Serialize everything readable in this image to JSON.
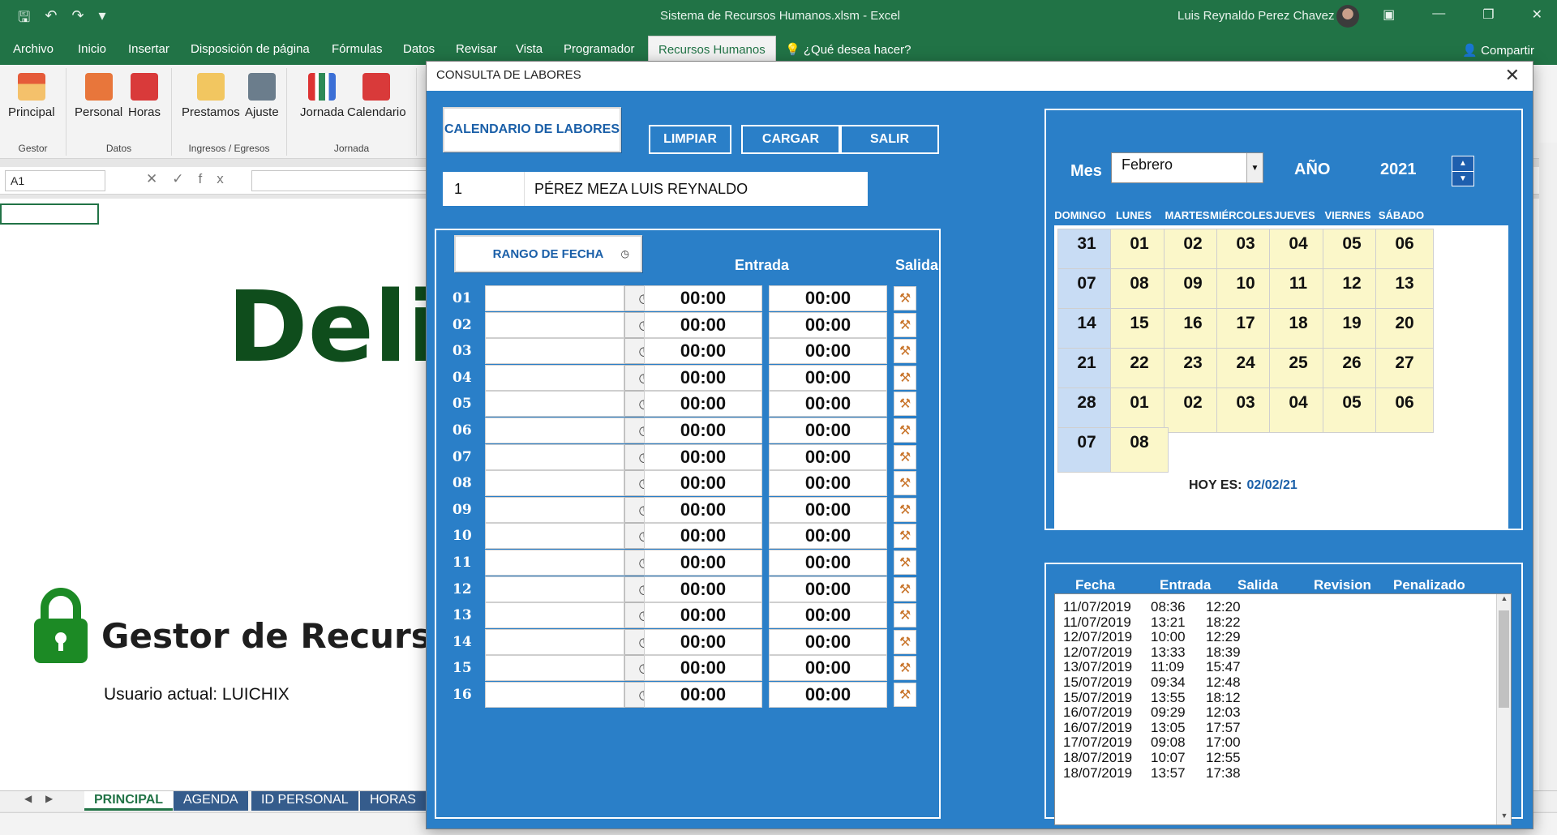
{
  "window": {
    "title": "Sistema de Recursos Humanos.xlsm  -  Excel",
    "user": "Luis Reynaldo Perez Chavez"
  },
  "ribbon_tabs": [
    "Archivo",
    "Inicio",
    "Insertar",
    "Disposición de página",
    "Fórmulas",
    "Datos",
    "Revisar",
    "Vista",
    "Programador",
    "Recursos Humanos"
  ],
  "tell_me": "¿Qué desea hacer?",
  "share": "Compartir",
  "ribbon_groups": [
    {
      "label": "Gestor",
      "buttons": [
        "Principal"
      ]
    },
    {
      "label": "Datos",
      "buttons": [
        "Personal",
        "Horas"
      ]
    },
    {
      "label": "Ingresos / Egresos",
      "buttons": [
        "Prestamos",
        "Ajuste"
      ]
    },
    {
      "label": "Jornada",
      "buttons": [
        "Jornada",
        "Calendario"
      ]
    }
  ],
  "namebox": "A1",
  "sheet": {
    "big_title": "Delic",
    "gestor": "Gestor de Recursos H",
    "usuario": "Usuario actual: LUICHIX"
  },
  "sheet_tabs": [
    "PRINCIPAL",
    "AGENDA",
    "ID PERSONAL",
    "HORAS"
  ],
  "form": {
    "caption": "CONSULTA DE LABORES",
    "calendario_btn": "CALENDARIO DE LABORES",
    "limpiar_btn": "LIMPIAR",
    "cargar_btn": "CARGAR",
    "salir_btn": "SALIR",
    "employee_id": "1",
    "employee_name": "PÉREZ MEZA LUIS REYNALDO",
    "rango_btn": "RANGO DE FECHA",
    "entrada_hdr": "Entrada",
    "salida_hdr": "Salida",
    "rows": [
      {
        "n": "01",
        "entrada": "00:00",
        "salida": "00:00"
      },
      {
        "n": "02",
        "entrada": "00:00",
        "salida": "00:00"
      },
      {
        "n": "03",
        "entrada": "00:00",
        "salida": "00:00"
      },
      {
        "n": "04",
        "entrada": "00:00",
        "salida": "00:00"
      },
      {
        "n": "05",
        "entrada": "00:00",
        "salida": "00:00"
      },
      {
        "n": "06",
        "entrada": "00:00",
        "salida": "00:00"
      },
      {
        "n": "07",
        "entrada": "00:00",
        "salida": "00:00"
      },
      {
        "n": "08",
        "entrada": "00:00",
        "salida": "00:00"
      },
      {
        "n": "09",
        "entrada": "00:00",
        "salida": "00:00"
      },
      {
        "n": "10",
        "entrada": "00:00",
        "salida": "00:00"
      },
      {
        "n": "11",
        "entrada": "00:00",
        "salida": "00:00"
      },
      {
        "n": "12",
        "entrada": "00:00",
        "salida": "00:00"
      },
      {
        "n": "13",
        "entrada": "00:00",
        "salida": "00:00"
      },
      {
        "n": "14",
        "entrada": "00:00",
        "salida": "00:00"
      },
      {
        "n": "15",
        "entrada": "00:00",
        "salida": "00:00"
      },
      {
        "n": "16",
        "entrada": "00:00",
        "salida": "00:00"
      }
    ],
    "calendar": {
      "mes_label": "Mes",
      "mes_value": "Febrero",
      "anio_label": "AÑO",
      "anio_value": "2021",
      "day_headers": [
        "DOMINGO",
        "LUNES",
        "MARTES",
        "MIÉRCOLES",
        "JUEVES",
        "VIERNES",
        "SÁBADO"
      ],
      "weeks": [
        [
          "31",
          "01",
          "02",
          "03",
          "04",
          "05",
          "06"
        ],
        [
          "07",
          "08",
          "09",
          "10",
          "11",
          "12",
          "13"
        ],
        [
          "14",
          "15",
          "16",
          "17",
          "18",
          "19",
          "20"
        ],
        [
          "21",
          "22",
          "23",
          "24",
          "25",
          "26",
          "27"
        ],
        [
          "28",
          "01",
          "02",
          "03",
          "04",
          "05",
          "06"
        ],
        [
          "07",
          "08"
        ]
      ],
      "hoy_label": "HOY ES:",
      "hoy_value": "02/02/21"
    },
    "list": {
      "headers": [
        "Fecha",
        "Entrada",
        "Salida",
        "Revision",
        "Penalizado"
      ],
      "rows": [
        [
          "11/07/2019",
          "08:36",
          "12:20"
        ],
        [
          "11/07/2019",
          "13:21",
          "18:22"
        ],
        [
          "12/07/2019",
          "10:00",
          "12:29"
        ],
        [
          "12/07/2019",
          "13:33",
          "18:39"
        ],
        [
          "13/07/2019",
          "11:09",
          "15:47"
        ],
        [
          "15/07/2019",
          "09:34",
          "12:48"
        ],
        [
          "15/07/2019",
          "13:55",
          "18:12"
        ],
        [
          "16/07/2019",
          "09:29",
          "12:03"
        ],
        [
          "16/07/2019",
          "13:05",
          "17:57"
        ],
        [
          "17/07/2019",
          "09:08",
          "17:00"
        ],
        [
          "18/07/2019",
          "10:07",
          "12:55"
        ],
        [
          "18/07/2019",
          "13:57",
          "17:38"
        ]
      ]
    }
  },
  "colors": {
    "excel_green": "#217346",
    "form_blue": "#2a7fc8",
    "sunday_cell": "#c8dcf4",
    "weekday_cell": "#fbf7c9",
    "accent_text": "#1a5fa8"
  }
}
